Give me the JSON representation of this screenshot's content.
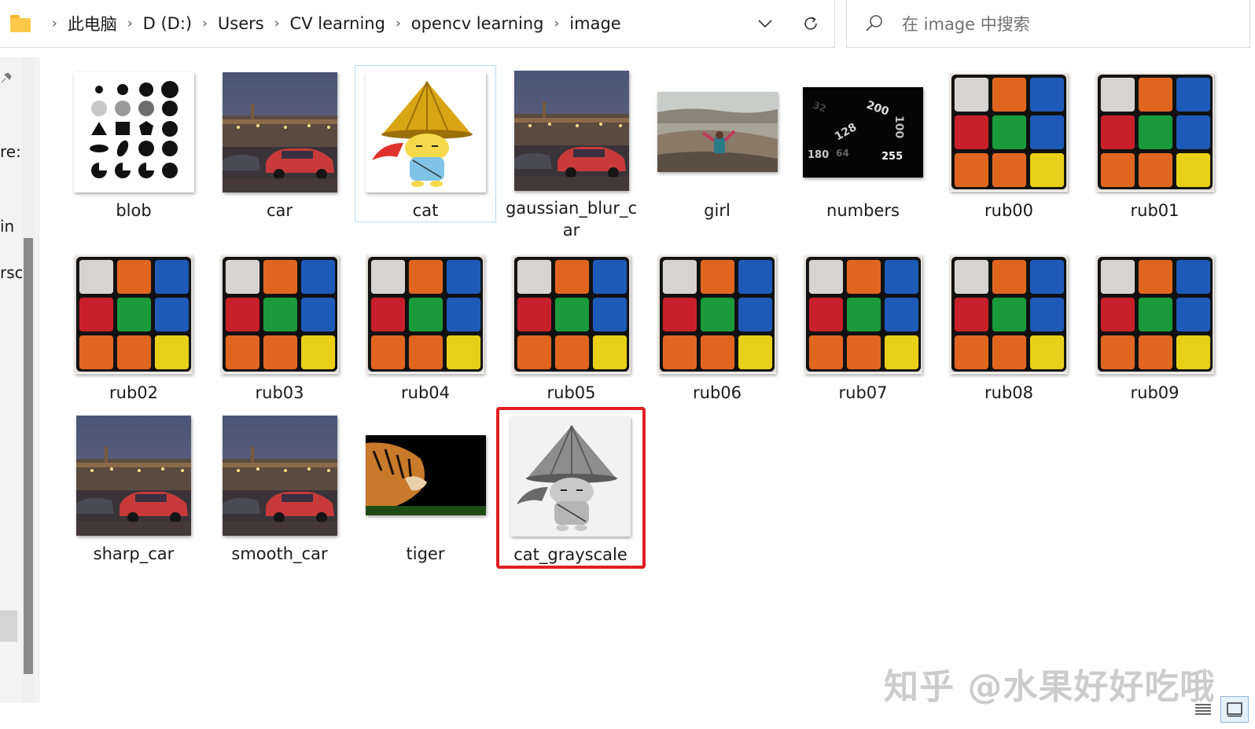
{
  "address_bar": {
    "breadcrumbs": [
      "此电脑",
      "D (D:)",
      "Users",
      "CV learning",
      "opencv learning",
      "image"
    ],
    "separator": "›"
  },
  "search": {
    "placeholder": "在 image 中搜索"
  },
  "nav": {
    "fragments": [
      "re:",
      "in",
      "rsc"
    ]
  },
  "files": [
    {
      "name": "blob",
      "thumb": "blob"
    },
    {
      "name": "car",
      "thumb": "car"
    },
    {
      "name": "cat",
      "thumb": "cat",
      "focused": true
    },
    {
      "name": "gaussian_blur_car",
      "thumb": "car"
    },
    {
      "name": "girl",
      "thumb": "girl"
    },
    {
      "name": "numbers",
      "thumb": "numbers"
    },
    {
      "name": "rub00",
      "thumb": "rub"
    },
    {
      "name": "rub01",
      "thumb": "rub"
    },
    {
      "name": "rub02",
      "thumb": "rub"
    },
    {
      "name": "rub03",
      "thumb": "rub"
    },
    {
      "name": "rub04",
      "thumb": "rub"
    },
    {
      "name": "rub05",
      "thumb": "rub"
    },
    {
      "name": "rub06",
      "thumb": "rub"
    },
    {
      "name": "rub07",
      "thumb": "rub"
    },
    {
      "name": "rub08",
      "thumb": "rub"
    },
    {
      "name": "rub09",
      "thumb": "rub"
    },
    {
      "name": "sharp_car",
      "thumb": "car"
    },
    {
      "name": "smooth_car",
      "thumb": "car"
    },
    {
      "name": "tiger",
      "thumb": "tiger"
    },
    {
      "name": "cat_grayscale",
      "thumb": "cat_gray",
      "highlighted": true
    }
  ],
  "numbers_thumb": {
    "labels": [
      "32",
      "200",
      "100",
      "128",
      "180",
      "64",
      "255"
    ]
  },
  "watermark": "知乎 @水果好好吃哦",
  "colors": {
    "highlight": "#e11e23",
    "folder": "#fcc84a",
    "focus": "#b9dcf0"
  },
  "icons": {
    "folder": "folder-icon",
    "dropdown": "chevron-down-icon",
    "refresh": "refresh-icon",
    "search": "search-icon",
    "details_view": "details-view-icon",
    "large_icons_view": "large-icons-view-icon"
  }
}
